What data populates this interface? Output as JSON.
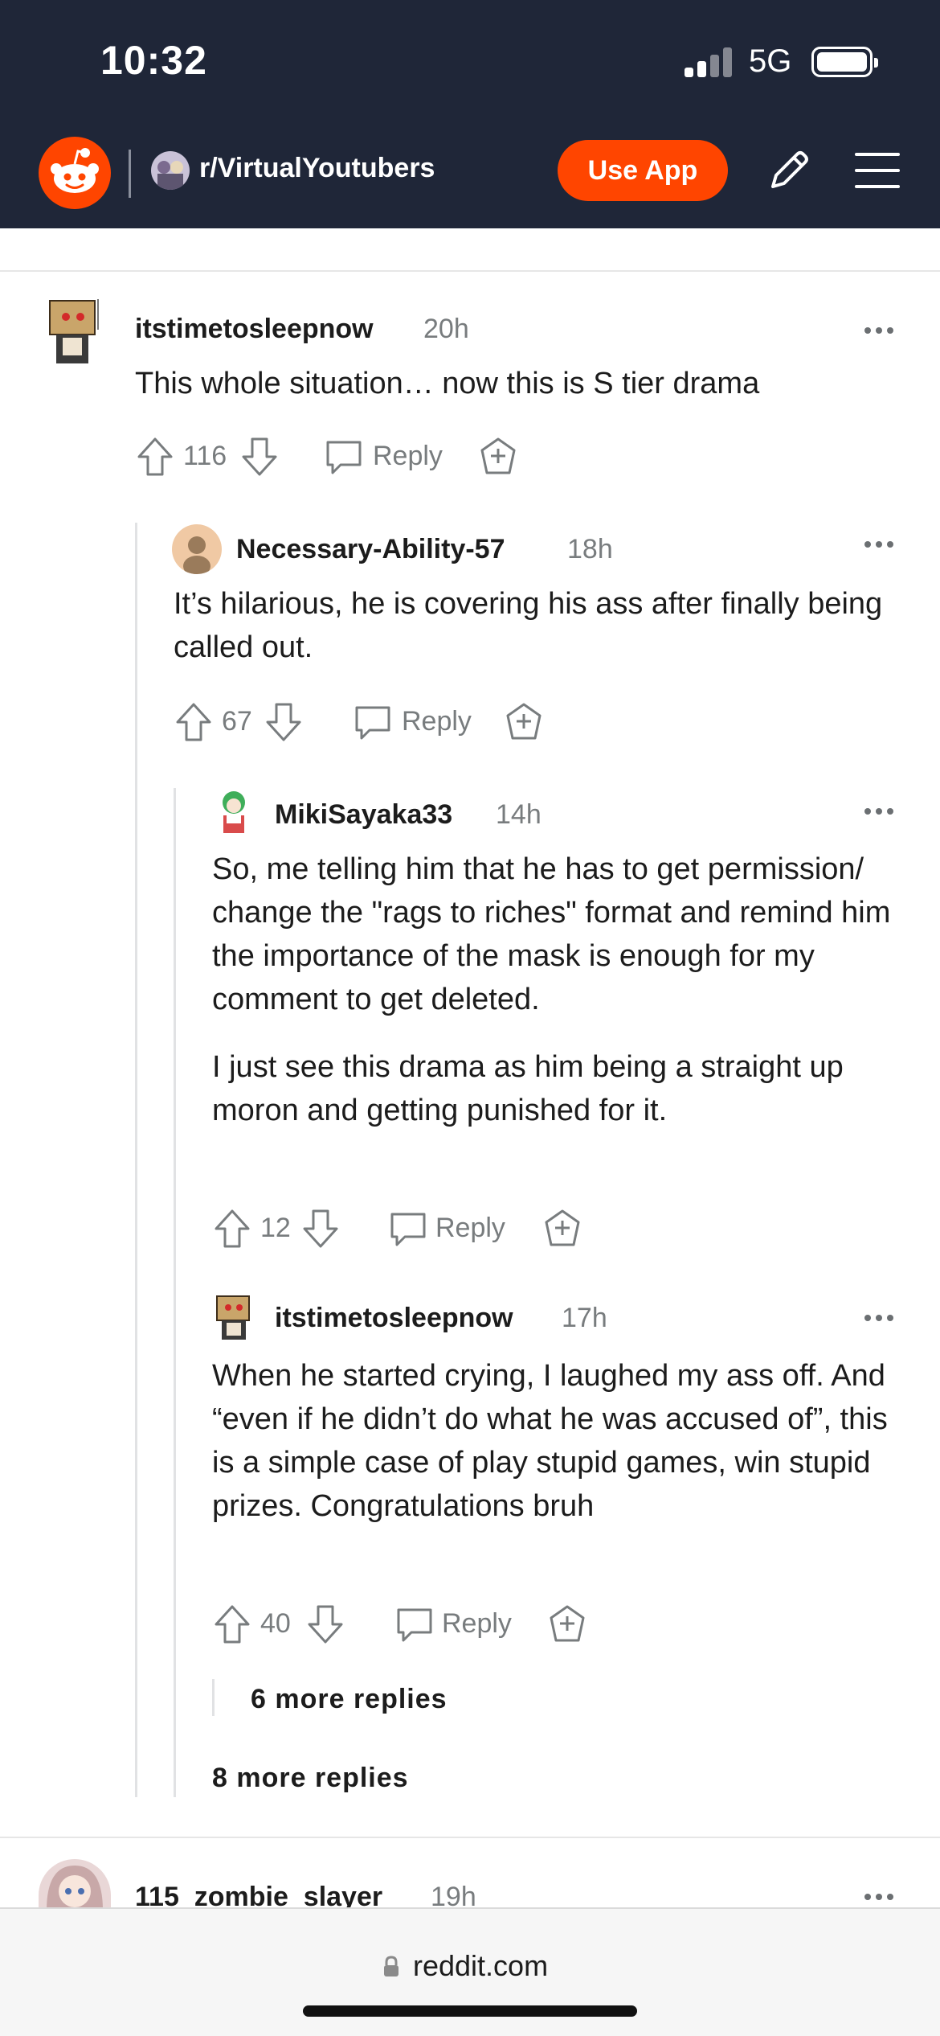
{
  "status_bar": {
    "time": "10:32",
    "network": "5G"
  },
  "nav": {
    "subreddit": "r/VirtualYoutubers",
    "use_app_label": "Use App",
    "brand_color": "#ff4500",
    "bar_color": "#1f2638"
  },
  "comments": [
    {
      "user": "itstimetosleepnow",
      "age": "20h",
      "paragraphs": [
        "This whole situation… now this is S tier drama"
      ],
      "score": "116",
      "reply_label": "Reply"
    },
    {
      "user": "Necessary-Ability-57",
      "age": "18h",
      "paragraphs": [
        "It’s hilarious, he is covering his ass after finally being called out."
      ],
      "score": "67",
      "reply_label": "Reply"
    },
    {
      "user": "MikiSayaka33",
      "age": "14h",
      "paragraphs": [
        "So, me telling him that he has to get permission/ change the \"rags to riches\" format and remind him the importance of the mask is enough for my comment to get deleted.",
        "I just see this drama as him being a straight up moron and getting punished for it."
      ],
      "score": "12",
      "reply_label": "Reply"
    },
    {
      "user": "itstimetosleepnow",
      "age": "17h",
      "paragraphs": [
        "When he started crying, I laughed my ass off. And “even if he didn’t do what he was accused of”, this is a simple case of play stupid games, win stupid prizes. Congratulations bruh"
      ],
      "score": "40",
      "reply_label": "Reply"
    },
    {
      "user": "115_zombie_slayer",
      "age": "19h"
    }
  ],
  "more_replies": [
    "6 more replies",
    "8 more replies"
  ],
  "browser": {
    "url": "reddit.com"
  }
}
